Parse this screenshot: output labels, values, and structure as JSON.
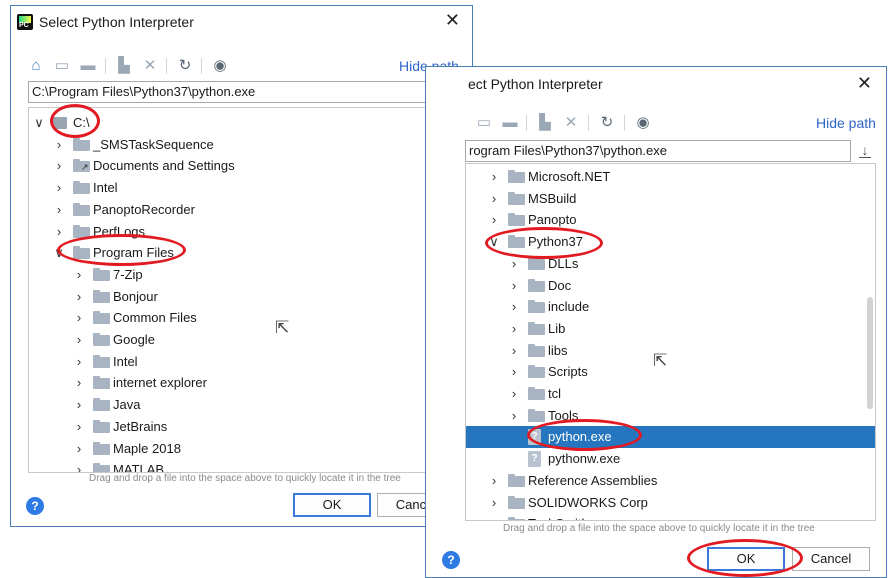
{
  "dialog_left": {
    "title": "Select Python Interpreter",
    "hide_path": "Hide path",
    "path_value": "C:\\Program Files\\Python37\\python.exe",
    "tree": [
      {
        "label": "C:\\",
        "chev": "∨",
        "icon": "drive"
      },
      {
        "label": "_SMSTaskSequence",
        "chev": "›",
        "icon": "folder"
      },
      {
        "label": "Documents and Settings",
        "chev": "›",
        "icon": "folder-link"
      },
      {
        "label": "Intel",
        "chev": "›",
        "icon": "folder"
      },
      {
        "label": "PanoptoRecorder",
        "chev": "›",
        "icon": "folder"
      },
      {
        "label": "PerfLogs",
        "chev": "›",
        "icon": "folder"
      },
      {
        "label": "Program Files",
        "chev": "∨",
        "icon": "folder"
      },
      {
        "label": "7-Zip",
        "chev": "›",
        "icon": "folder"
      },
      {
        "label": "Bonjour",
        "chev": "›",
        "icon": "folder"
      },
      {
        "label": "Common Files",
        "chev": "›",
        "icon": "folder"
      },
      {
        "label": "Google",
        "chev": "›",
        "icon": "folder"
      },
      {
        "label": "Intel",
        "chev": "›",
        "icon": "folder"
      },
      {
        "label": "internet explorer",
        "chev": "›",
        "icon": "folder"
      },
      {
        "label": "Java",
        "chev": "›",
        "icon": "folder"
      },
      {
        "label": "JetBrains",
        "chev": "›",
        "icon": "folder"
      },
      {
        "label": "Maple 2018",
        "chev": "›",
        "icon": "folder"
      },
      {
        "label": "MATLAB",
        "chev": "›",
        "icon": "folder"
      }
    ],
    "hint": "Drag and drop a file into the space above to quickly locate it in the tree",
    "help": "?",
    "ok": "OK",
    "cancel": "Cancel"
  },
  "dialog_right": {
    "title": "ect Python Interpreter",
    "hide_path": "Hide path",
    "path_value": "rogram Files\\Python37\\python.exe",
    "tree": [
      {
        "label": "Microsoft.NET",
        "chev": "›",
        "icon": "folder"
      },
      {
        "label": "MSBuild",
        "chev": "›",
        "icon": "folder"
      },
      {
        "label": "Panopto",
        "chev": "›",
        "icon": "folder"
      },
      {
        "label": "Python37",
        "chev": "∨",
        "icon": "folder"
      },
      {
        "label": "DLLs",
        "chev": "›",
        "icon": "folder"
      },
      {
        "label": "Doc",
        "chev": "›",
        "icon": "folder"
      },
      {
        "label": "include",
        "chev": "›",
        "icon": "folder"
      },
      {
        "label": "Lib",
        "chev": "›",
        "icon": "folder"
      },
      {
        "label": "libs",
        "chev": "›",
        "icon": "folder"
      },
      {
        "label": "Scripts",
        "chev": "›",
        "icon": "folder"
      },
      {
        "label": "tcl",
        "chev": "›",
        "icon": "folder"
      },
      {
        "label": "Tools",
        "chev": "›",
        "icon": "folder"
      },
      {
        "label": "python.exe",
        "chev": "",
        "icon": "python-file",
        "selected": true
      },
      {
        "label": "pythonw.exe",
        "chev": "",
        "icon": "python-file"
      },
      {
        "label": "Reference Assemblies",
        "chev": "›",
        "icon": "folder"
      },
      {
        "label": "SOLIDWORKS Corp",
        "chev": "›",
        "icon": "folder"
      },
      {
        "label": "TechSmith",
        "chev": "›",
        "icon": "folder"
      }
    ],
    "hint": "Drag and drop a file into the space above to quickly locate it in the tree",
    "help": "?",
    "ok": "OK",
    "cancel": "Cancel"
  },
  "colors": {
    "selection": "#2675bf",
    "annotation": "#e21b23",
    "link": "#2f65ca",
    "default_button_border": "#3b78d8"
  }
}
